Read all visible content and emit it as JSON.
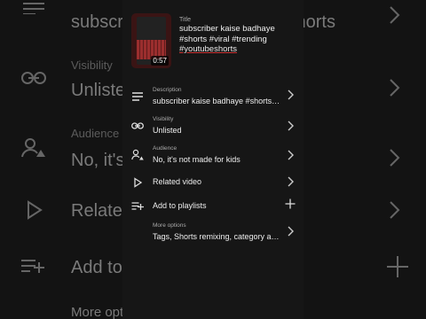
{
  "video": {
    "title_label": "Title",
    "title_line1": "subscriber kaise badhaye",
    "title_line2": "#shorts #viral #trending",
    "title_line3": "#youtubeshorts",
    "duration": "0:57"
  },
  "rows": [
    {
      "label": "Description",
      "value": "subscriber kaise badhaye #shorts…",
      "icon": "description-icon",
      "action": "chevron-right"
    },
    {
      "label": "Visibility",
      "value": "Unlisted",
      "icon": "link-icon",
      "action": "chevron-right"
    },
    {
      "label": "Audience",
      "value": "No, it's not made for kids",
      "icon": "audience-icon",
      "action": "chevron-right"
    },
    {
      "label": "",
      "value": "Related video",
      "icon": "play-icon",
      "action": "chevron-right"
    },
    {
      "label": "",
      "value": "Add to playlists",
      "icon": "playlist-add-icon",
      "action": "plus"
    },
    {
      "label": "More options",
      "value": "Tags, Shorts remixing, category a…",
      "icon": "",
      "action": "chevron-right"
    }
  ],
  "background": {
    "texts": [
      "subscriber kaise badhaye #shorts",
      "Unlisted",
      "No, it's",
      "Relate",
      "Add to",
      "More opt"
    ],
    "labels": [
      "Visibility",
      "Audience"
    ]
  }
}
